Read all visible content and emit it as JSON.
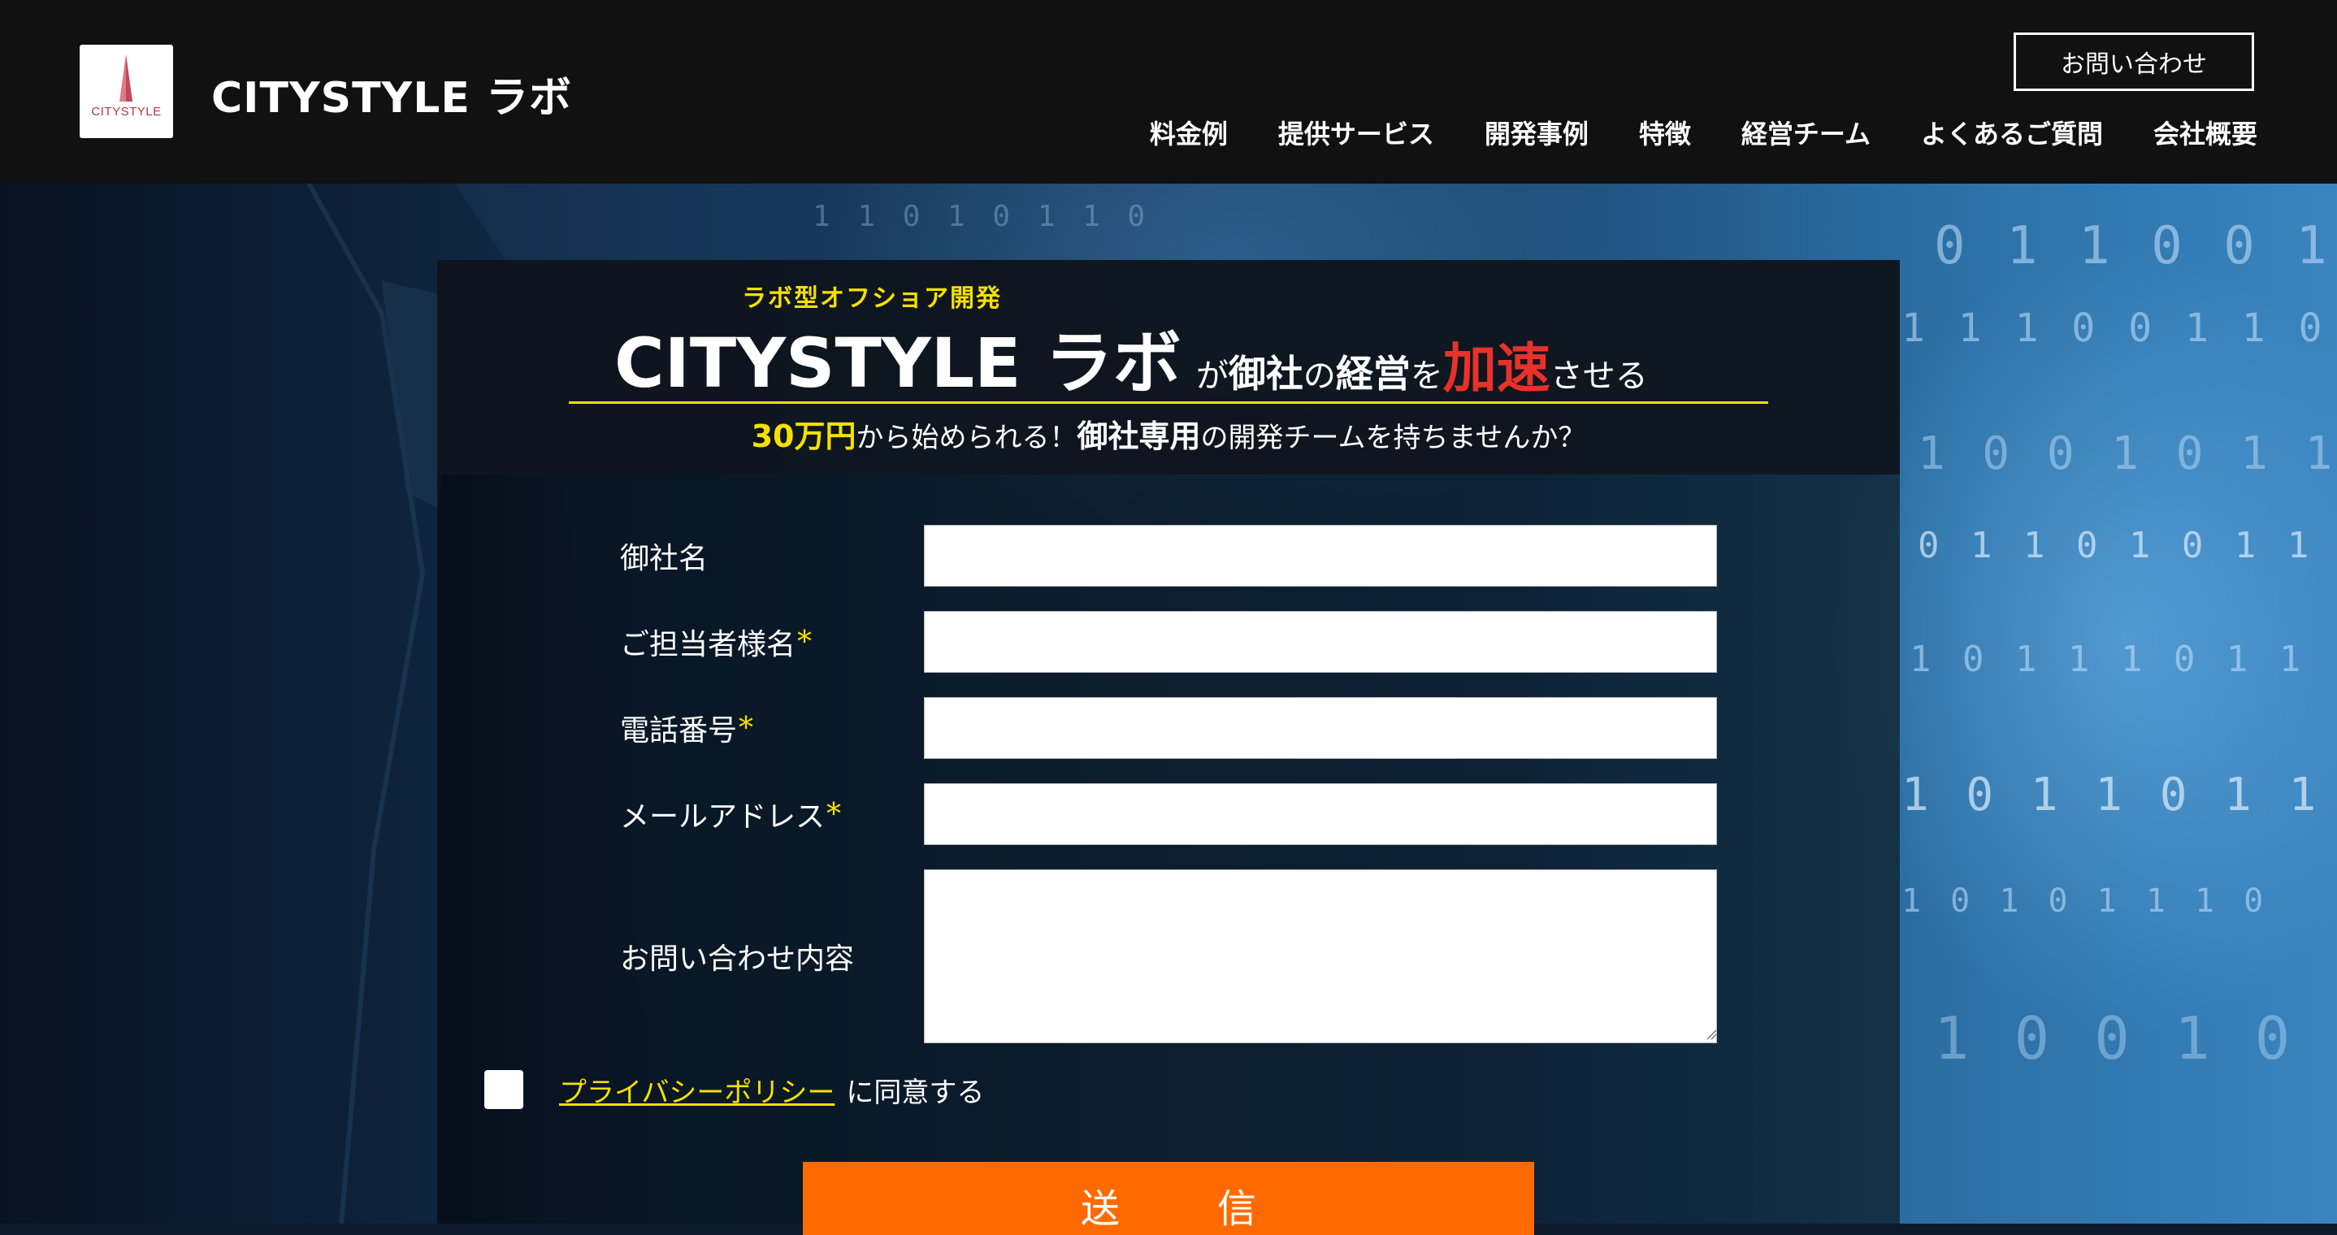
{
  "header": {
    "logo_text": "CITYSTYLE",
    "brand": "CITYSTYLE ラボ",
    "contact_button": "お問い合わせ",
    "nav": [
      "料金例",
      "提供サービス",
      "開発事例",
      "特徴",
      "経営チーム",
      "よくあるご質問",
      "会社概要"
    ]
  },
  "hero": {
    "kicker": "ラボ型オフショア開発",
    "headline": {
      "brand": "CITYSTYLE ラボ",
      "ga": "が",
      "onsha": "御社",
      "no": "の",
      "keiei": "経営",
      "wo": "を",
      "accent": "加速",
      "saseru": "させる"
    },
    "subline": {
      "price": "30万円",
      "part1": "から始められる！",
      "bold": "御社専用",
      "part2": "の開発チームを持ちませんか？"
    }
  },
  "form": {
    "company_label": "御社名",
    "contact_person_label": "ご担当者様名",
    "phone_label": "電話番号",
    "email_label": "メールアドレス",
    "inquiry_label": "お問い合わせ内容",
    "required_mark": "*",
    "company_value": "",
    "contact_person_value": "",
    "phone_value": "",
    "email_value": "",
    "inquiry_value": "",
    "privacy_link": "プライバシーポリシー",
    "privacy_suffix": "に同意する",
    "submit_label": "送信"
  },
  "colors": {
    "accent_yellow": "#f5e000",
    "accent_red": "#e8312a",
    "submit_orange": "#ff6a00",
    "header_bg": "#111111"
  }
}
